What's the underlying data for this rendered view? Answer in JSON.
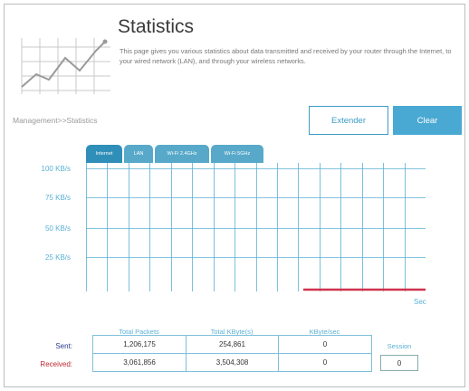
{
  "header": {
    "title": "Statistics",
    "description": "This page gives you various statistics about data transmitted and received by your router through the Internet, to your wired network (LAN), and through your wireless networks."
  },
  "breadcrumb": "Management>>Statistics",
  "buttons": {
    "extender": "Extender",
    "clear": "Clear"
  },
  "tabs": [
    {
      "label": "Internet",
      "active": true
    },
    {
      "label": "LAN",
      "active": false
    },
    {
      "label": "Wi-Fi 2.4GHz",
      "active": false
    },
    {
      "label": "Wi-Fi 5GHz",
      "active": false
    }
  ],
  "graph": {
    "y_labels": [
      "100 KB/s",
      "75 KB/s",
      "50 KB/s",
      "25 KB/s"
    ],
    "x_unit": "Sec",
    "line_color": "#d0334d",
    "grid_color": "#5ab1d4"
  },
  "table": {
    "headers": [
      "Total Packets",
      "Total KByte(s)",
      "KByte/sec"
    ],
    "rows": [
      {
        "label": "Sent:",
        "packets": "1,206,175",
        "kbytes": "254,861",
        "rate": "0"
      },
      {
        "label": "Received:",
        "packets": "3,061,856",
        "kbytes": "3,504,308",
        "rate": "0"
      }
    ],
    "session_label": "Session",
    "session_value": "0"
  },
  "colors": {
    "accent": "#4aa9d3",
    "sent": "#2a3b8f",
    "received": "#c0262f"
  }
}
